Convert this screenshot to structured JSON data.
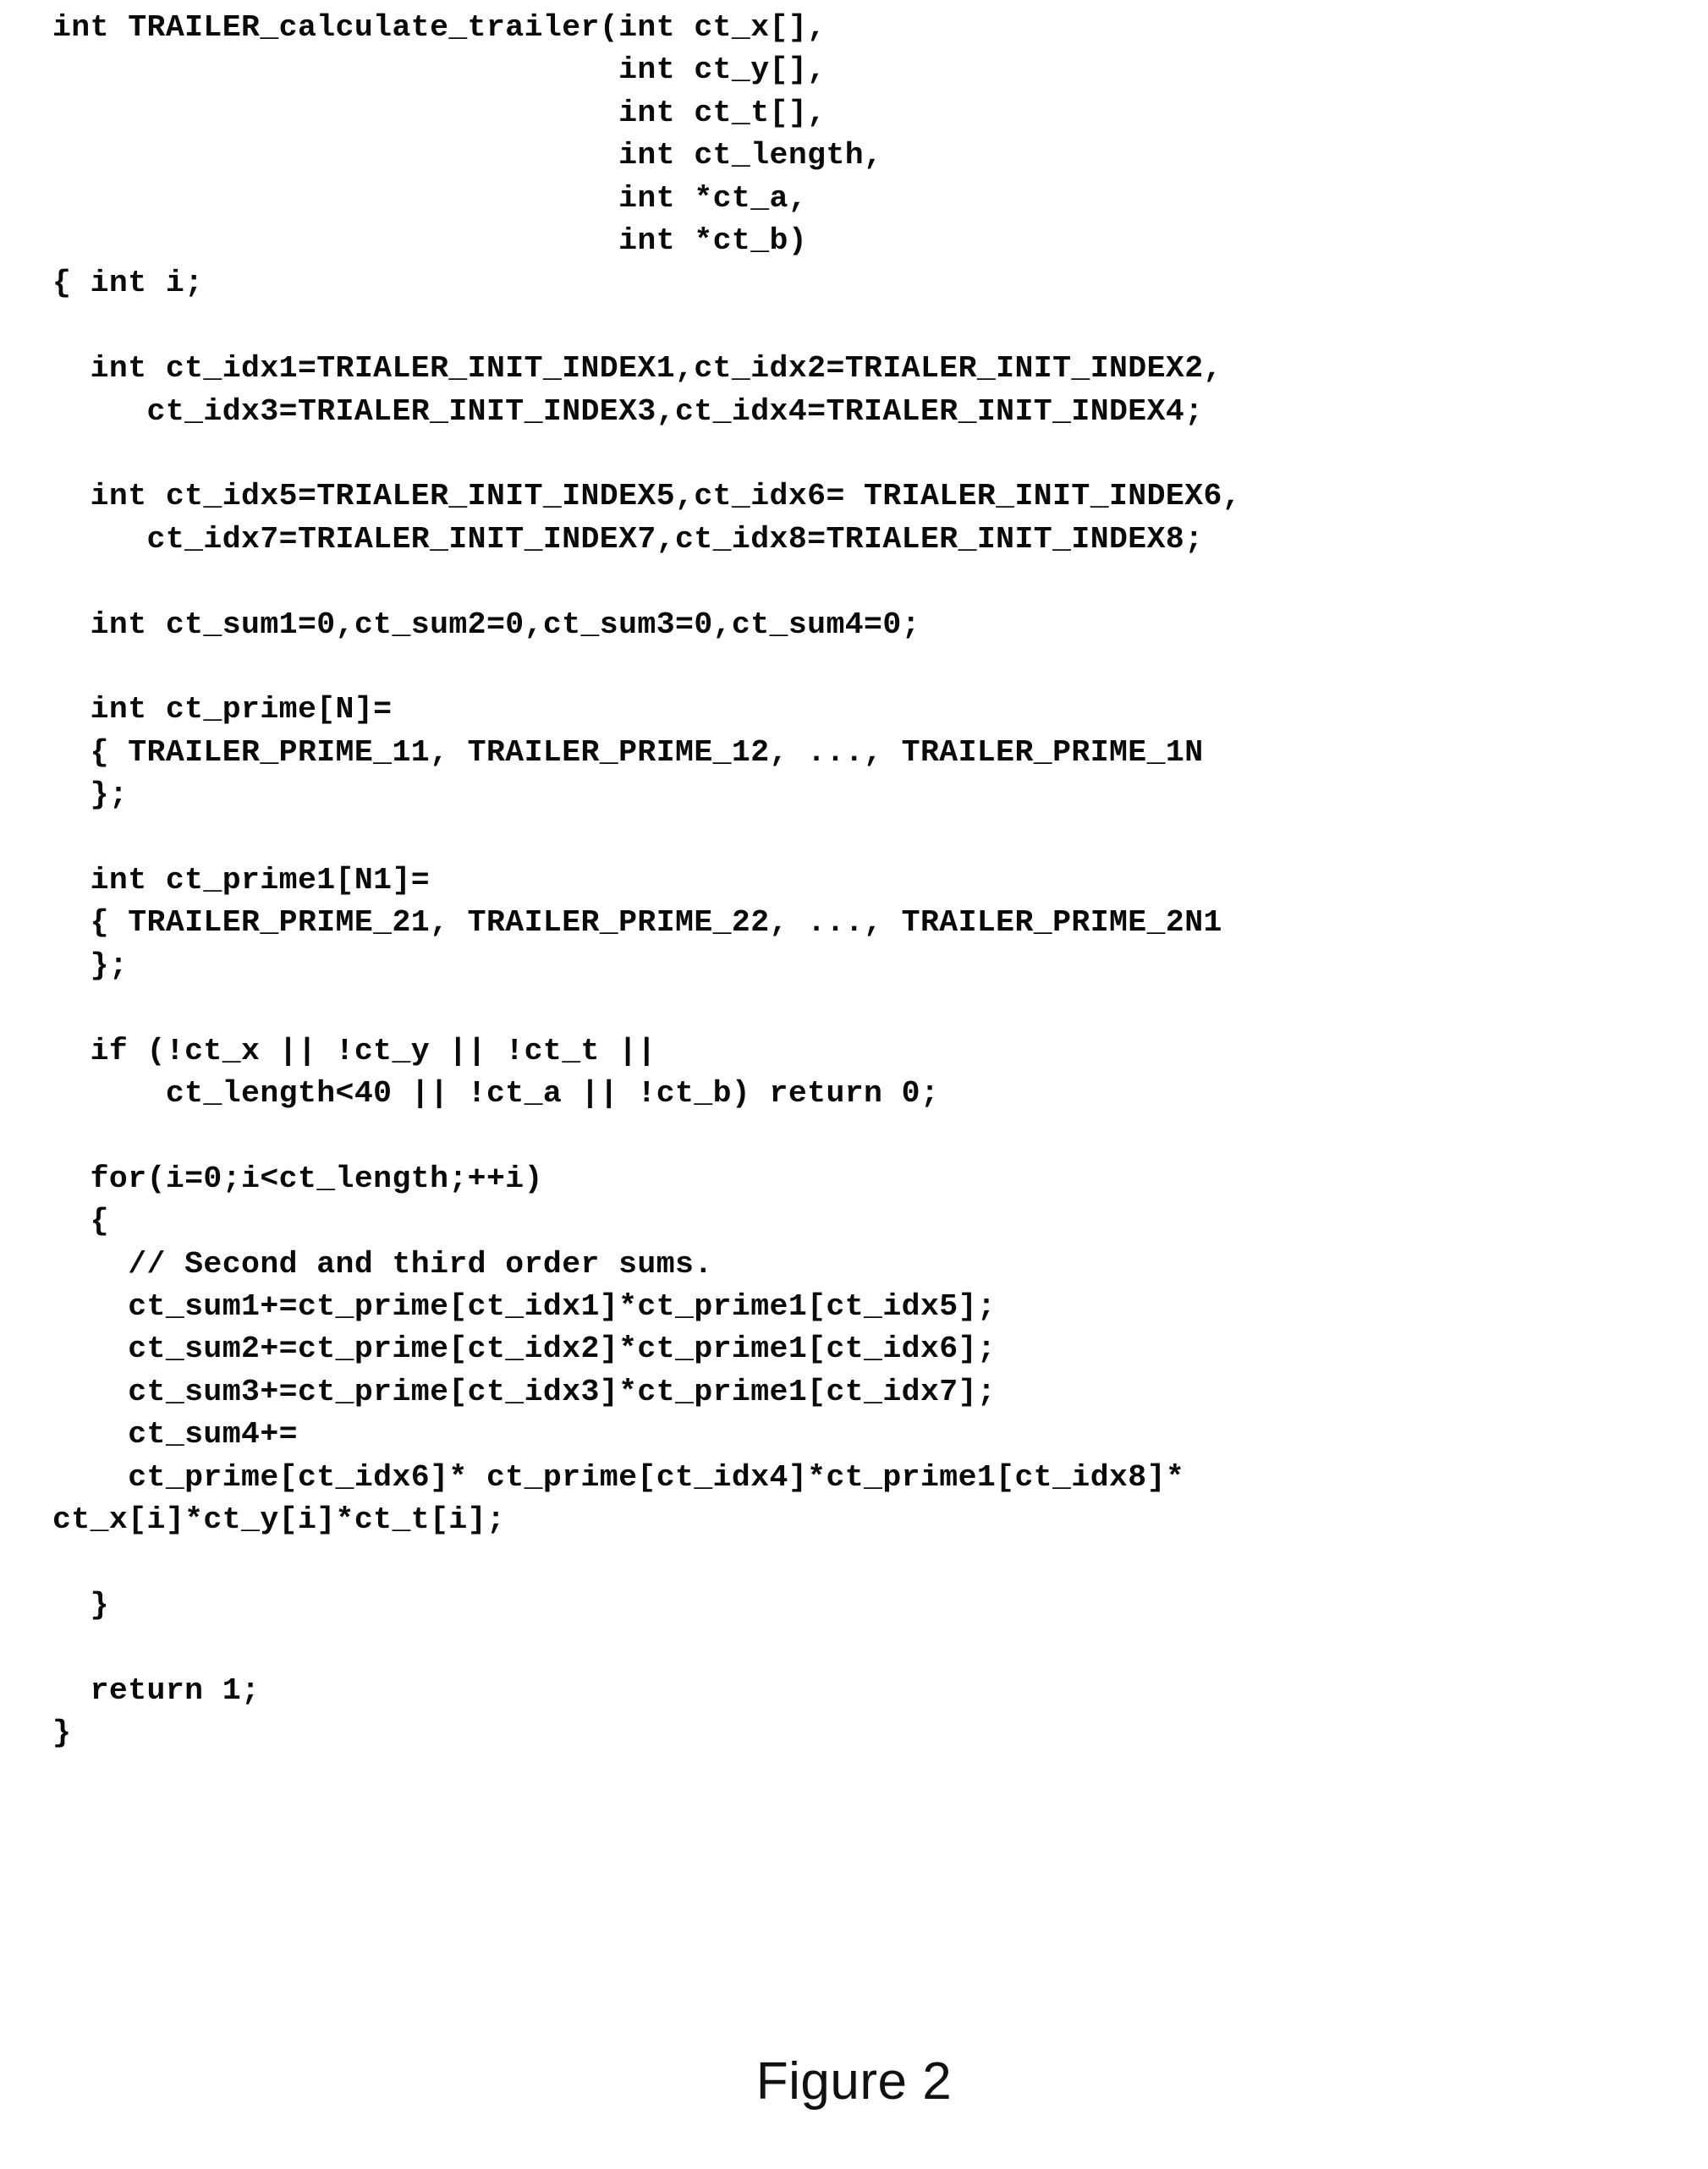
{
  "document": {
    "type": "patent-figure",
    "caption": "Figure 2",
    "language": "c"
  },
  "code": {
    "language": "C",
    "function_name": "TRAILER_calculate_trailer",
    "lines": [
      "int TRAILER_calculate_trailer(int ct_x[],",
      "                              int ct_y[],",
      "                              int ct_t[],",
      "                              int ct_length,",
      "                              int *ct_a,",
      "                              int *ct_b)",
      "{ int i;",
      "",
      "  int ct_idx1=TRIALER_INIT_INDEX1,ct_idx2=TRIALER_INIT_INDEX2,",
      "     ct_idx3=TRIALER_INIT_INDEX3,ct_idx4=TRIALER_INIT_INDEX4;",
      "",
      "  int ct_idx5=TRIALER_INIT_INDEX5,ct_idx6= TRIALER_INIT_INDEX6,",
      "     ct_idx7=TRIALER_INIT_INDEX7,ct_idx8=TRIALER_INIT_INDEX8;",
      "",
      "  int ct_sum1=0,ct_sum2=0,ct_sum3=0,ct_sum4=0;",
      "",
      "  int ct_prime[N]=",
      "  { TRAILER_PRIME_11, TRAILER_PRIME_12, ..., TRAILER_PRIME_1N",
      "  };",
      "",
      "  int ct_prime1[N1]=",
      "  { TRAILER_PRIME_21, TRAILER_PRIME_22, ..., TRAILER_PRIME_2N1",
      "  };",
      "",
      "  if (!ct_x || !ct_y || !ct_t ||",
      "      ct_length<40 || !ct_a || !ct_b) return 0;",
      "",
      "  for(i=0;i<ct_length;++i)",
      "  {",
      "    // Second and third order sums.",
      "    ct_sum1+=ct_prime[ct_idx1]*ct_prime1[ct_idx5];",
      "    ct_sum2+=ct_prime[ct_idx2]*ct_prime1[ct_idx6];",
      "    ct_sum3+=ct_prime[ct_idx3]*ct_prime1[ct_idx7];",
      "    ct_sum4+=",
      "    ct_prime[ct_idx6]* ct_prime[ct_idx4]*ct_prime1[ct_idx8]*",
      "ct_x[i]*ct_y[i]*ct_t[i];",
      "",
      "  }",
      "",
      "  return 1;",
      "}"
    ]
  }
}
